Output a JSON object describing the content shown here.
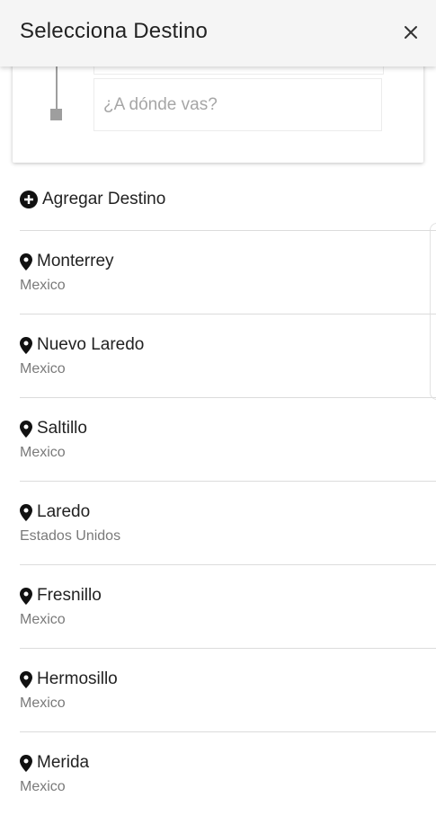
{
  "header": {
    "title": "Selecciona Destino",
    "close_icon": "close-icon"
  },
  "search": {
    "placeholder": "¿A dónde vas?"
  },
  "add_destination": {
    "label": "Agregar Destino",
    "icon": "add-circle-icon"
  },
  "destinations": [
    {
      "name": "Monterrey",
      "country": "Mexico",
      "icon": "map-pin-icon"
    },
    {
      "name": "Nuevo Laredo",
      "country": "Mexico",
      "icon": "map-pin-icon"
    },
    {
      "name": "Saltillo",
      "country": "Mexico",
      "icon": "map-pin-icon"
    },
    {
      "name": "Laredo",
      "country": "Estados Unidos",
      "icon": "map-pin-icon"
    },
    {
      "name": "Fresnillo",
      "country": "Mexico",
      "icon": "map-pin-icon"
    },
    {
      "name": "Hermosillo",
      "country": "Mexico",
      "icon": "map-pin-icon"
    },
    {
      "name": "Merida",
      "country": "Mexico",
      "icon": "map-pin-icon"
    }
  ],
  "colors": {
    "header_bg": "#f5f5f5",
    "divider": "#dcdcdc",
    "muted_text": "#7a7a7a"
  }
}
